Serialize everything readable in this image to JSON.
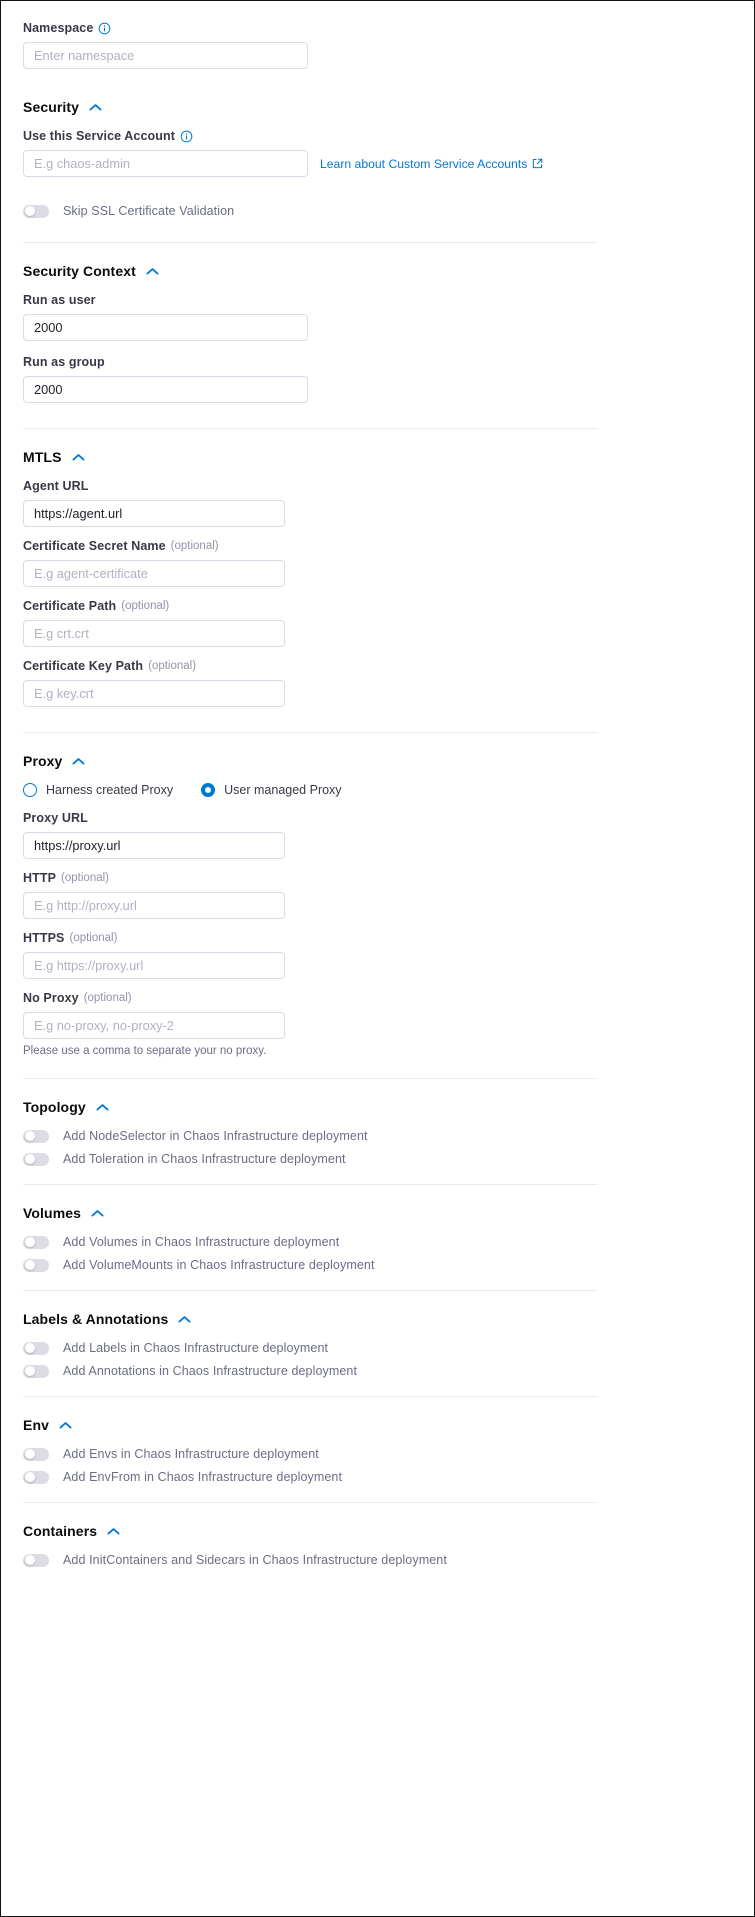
{
  "namespace": {
    "label": "Namespace",
    "placeholder": "Enter namespace",
    "value": ""
  },
  "security": {
    "title": "Security",
    "service_account": {
      "label": "Use this Service Account",
      "placeholder": "E.g chaos-admin",
      "value": ""
    },
    "link": {
      "text": "Learn about Custom Service Accounts",
      "icon": "external-link-icon"
    },
    "skip_ssl": {
      "label": "Skip SSL Certificate Validation",
      "state": "off"
    }
  },
  "security_context": {
    "title": "Security Context",
    "run_as_user": {
      "label": "Run as user",
      "value": "2000"
    },
    "run_as_group": {
      "label": "Run as group",
      "value": "2000"
    }
  },
  "mtls": {
    "title": "MTLS",
    "agent_url": {
      "label": "Agent URL",
      "value": "https://agent.url"
    },
    "cert_secret_name": {
      "label": "Certificate Secret Name",
      "optional": "(optional)",
      "placeholder": "E.g agent-certificate",
      "value": ""
    },
    "cert_path": {
      "label": "Certificate Path",
      "optional": "(optional)",
      "placeholder": "E.g crt.crt",
      "value": ""
    },
    "cert_key_path": {
      "label": "Certificate Key Path",
      "optional": "(optional)",
      "placeholder": "E.g key.crt",
      "value": ""
    }
  },
  "proxy": {
    "title": "Proxy",
    "options": [
      {
        "label": "Harness created Proxy",
        "selected": false
      },
      {
        "label": "User managed Proxy",
        "selected": true
      }
    ],
    "proxy_url": {
      "label": "Proxy URL",
      "value": "https://proxy.url"
    },
    "http": {
      "label": "HTTP",
      "optional": "(optional)",
      "placeholder": "E.g http://proxy.url",
      "value": ""
    },
    "https": {
      "label": "HTTPS",
      "optional": "(optional)",
      "placeholder": "E.g https://proxy.url",
      "value": ""
    },
    "no_proxy": {
      "label": "No Proxy",
      "optional": "(optional)",
      "placeholder": "E.g no-proxy, no-proxy-2",
      "value": "",
      "helper": "Please use a comma to separate your no proxy."
    }
  },
  "topology": {
    "title": "Topology",
    "toggles": [
      {
        "label": "Add NodeSelector in Chaos Infrastructure deployment",
        "state": "off"
      },
      {
        "label": "Add Toleration in Chaos Infrastructure deployment",
        "state": "off"
      }
    ]
  },
  "volumes": {
    "title": "Volumes",
    "toggles": [
      {
        "label": "Add Volumes in Chaos Infrastructure deployment",
        "state": "off"
      },
      {
        "label": "Add VolumeMounts in Chaos Infrastructure deployment",
        "state": "off"
      }
    ]
  },
  "labels_annotations": {
    "title": "Labels & Annotations",
    "toggles": [
      {
        "label": "Add Labels in Chaos Infrastructure deployment",
        "state": "off"
      },
      {
        "label": "Add Annotations in Chaos Infrastructure deployment",
        "state": "off"
      }
    ]
  },
  "env": {
    "title": "Env",
    "toggles": [
      {
        "label": "Add Envs in Chaos Infrastructure deployment",
        "state": "off"
      },
      {
        "label": "Add EnvFrom in Chaos Infrastructure deployment",
        "state": "off"
      }
    ]
  },
  "containers": {
    "title": "Containers",
    "toggles": [
      {
        "label": "Add InitContainers and Sidecars in Chaos Infrastructure deployment",
        "state": "off"
      }
    ]
  },
  "colors": {
    "accent": "#0278d5",
    "link": "#0278d5",
    "label": "#383946",
    "muted": "#6b6d85",
    "border": "#d9dae5",
    "divider": "#e8e8ee"
  }
}
